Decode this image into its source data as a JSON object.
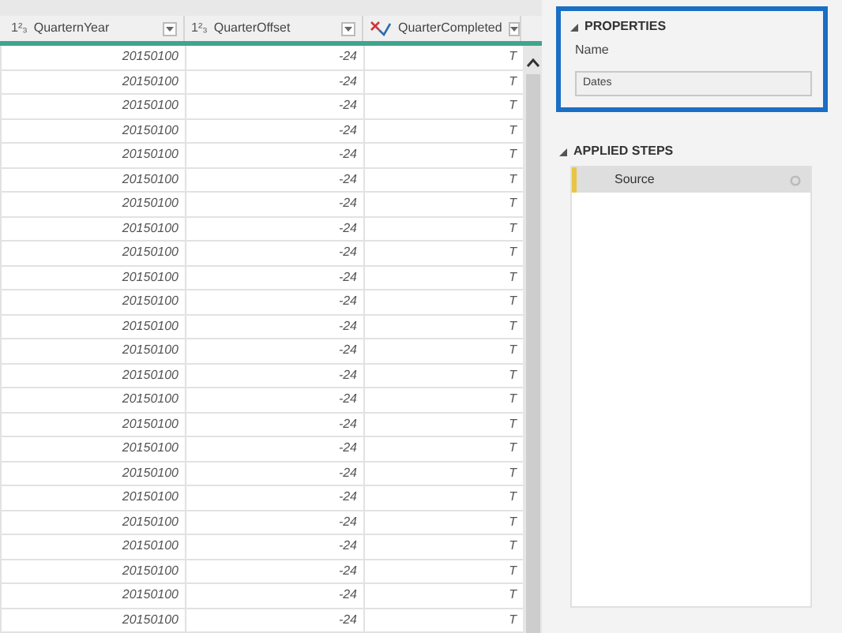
{
  "table": {
    "columns": [
      {
        "kind": "number",
        "type_icon": "1²₃",
        "label": "QuarternYear"
      },
      {
        "kind": "number",
        "type_icon": "1²₃",
        "label": "QuarterOffset"
      },
      {
        "kind": "logical",
        "label": "QuarterCompleted"
      }
    ],
    "rows": [
      {
        "cells": [
          "20150100",
          "-24",
          "T"
        ]
      },
      {
        "cells": [
          "20150100",
          "-24",
          "T"
        ]
      },
      {
        "cells": [
          "20150100",
          "-24",
          "T"
        ]
      },
      {
        "cells": [
          "20150100",
          "-24",
          "T"
        ]
      },
      {
        "cells": [
          "20150100",
          "-24",
          "T"
        ]
      },
      {
        "cells": [
          "20150100",
          "-24",
          "T"
        ]
      },
      {
        "cells": [
          "20150100",
          "-24",
          "T"
        ]
      },
      {
        "cells": [
          "20150100",
          "-24",
          "T"
        ]
      },
      {
        "cells": [
          "20150100",
          "-24",
          "T"
        ]
      },
      {
        "cells": [
          "20150100",
          "-24",
          "T"
        ]
      },
      {
        "cells": [
          "20150100",
          "-24",
          "T"
        ]
      },
      {
        "cells": [
          "20150100",
          "-24",
          "T"
        ]
      },
      {
        "cells": [
          "20150100",
          "-24",
          "T"
        ]
      },
      {
        "cells": [
          "20150100",
          "-24",
          "T"
        ]
      },
      {
        "cells": [
          "20150100",
          "-24",
          "T"
        ]
      },
      {
        "cells": [
          "20150100",
          "-24",
          "T"
        ]
      },
      {
        "cells": [
          "20150100",
          "-24",
          "T"
        ]
      },
      {
        "cells": [
          "20150100",
          "-24",
          "T"
        ]
      },
      {
        "cells": [
          "20150100",
          "-24",
          "T"
        ]
      },
      {
        "cells": [
          "20150100",
          "-24",
          "T"
        ]
      },
      {
        "cells": [
          "20150100",
          "-24",
          "T"
        ]
      },
      {
        "cells": [
          "20150100",
          "-24",
          "T"
        ]
      },
      {
        "cells": [
          "20150100",
          "-24",
          "T"
        ]
      },
      {
        "cells": [
          "20150100",
          "-24",
          "T"
        ]
      }
    ]
  },
  "properties": {
    "title": "PROPERTIES",
    "name_label": "Name",
    "name_value": "Dates"
  },
  "applied_steps": {
    "title": "APPLIED STEPS",
    "steps": [
      {
        "label": "Source",
        "selected": true
      }
    ]
  }
}
